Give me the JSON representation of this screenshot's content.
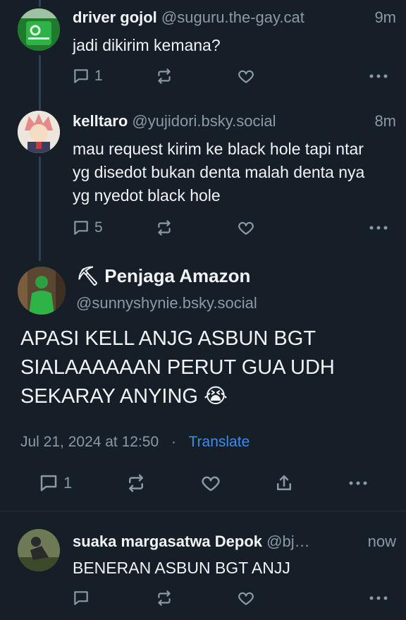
{
  "posts": [
    {
      "author": "driver gojol",
      "handle": "@suguru.the-gay.cat",
      "time": "9m",
      "text": "jadi dikirim kemana?",
      "replies": "1",
      "reposts": "",
      "likes": ""
    },
    {
      "author": "kelltaro",
      "handle": "@yujidori.bsky.social",
      "time": "8m",
      "text": "mau request kirim ke black hole tapi ntar yg disedot bukan denta malah denta nya yg nyedot black hole",
      "replies": "5",
      "reposts": "",
      "likes": ""
    }
  ],
  "focused": {
    "author_icon": "⛏",
    "author": "Penjaga Amazon",
    "handle": "@sunnyshynie.bsky.social",
    "text": "APASI KELL ANJG ASBUN BGT SIALAAAAAAN PERUT GUA UDH SEKARAY ANYING",
    "emoji": "😭",
    "date": "Jul 21, 2024 at 12:50",
    "separator": "·",
    "translate": "Translate",
    "replies": "1"
  },
  "reply": {
    "author": "suaka margasatwa Depok",
    "handle": "@bj…",
    "time": "now",
    "text": "BENERAN ASBUN BGT ANJJ"
  },
  "colors": {
    "background": "#161e27",
    "muted": "#8b99a8",
    "link": "#3b8ef0",
    "thread_line": "#2e4052"
  }
}
